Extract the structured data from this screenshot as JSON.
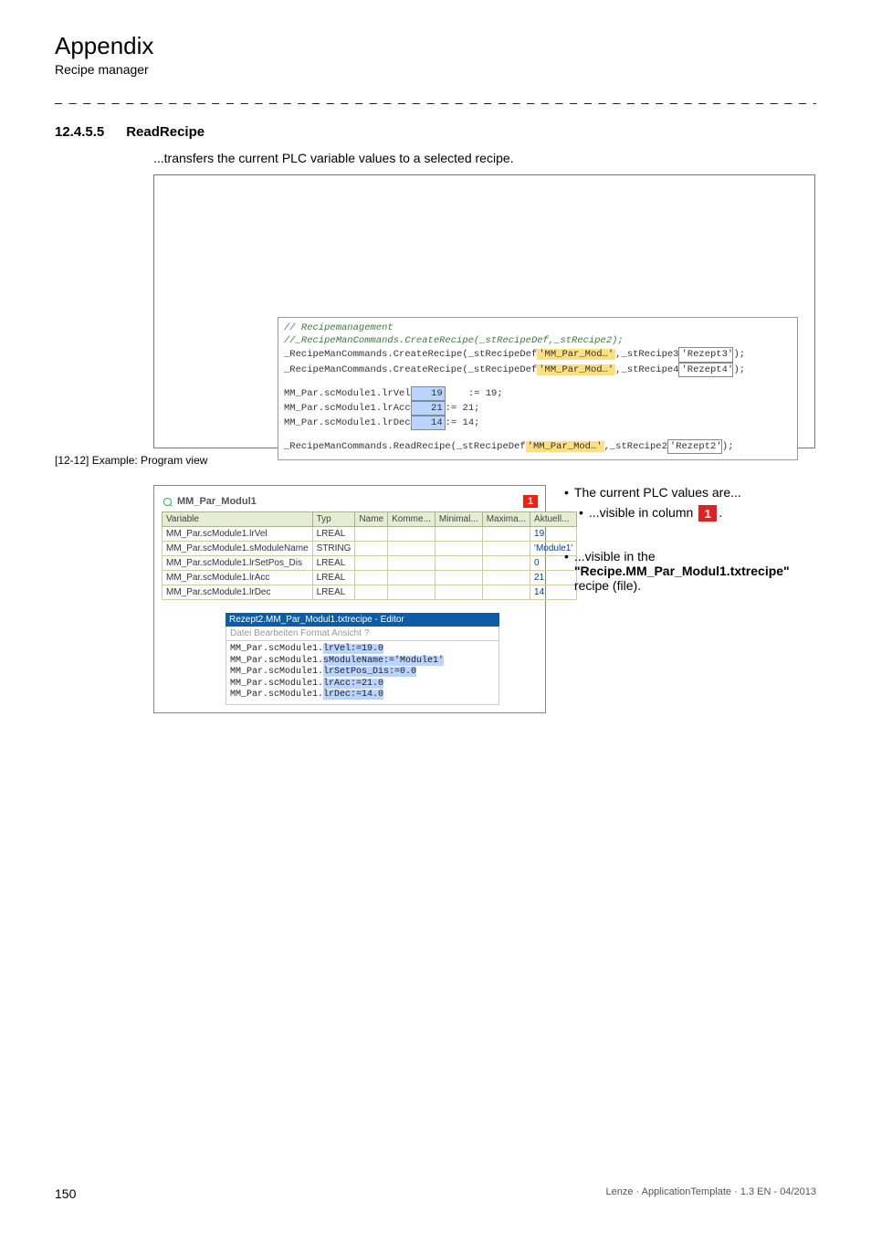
{
  "header": {
    "title": "Appendix",
    "subtitle": "Recipe manager"
  },
  "section": {
    "number": "12.4.5.5",
    "title": "ReadRecipe",
    "description": "...transfers the current PLC variable values to a selected recipe."
  },
  "code_panel": {
    "c1": "// Recipemanagement",
    "c2": "//_RecipeManCommands.CreateRecipe(_stRecipeDef,_stRecipe2);",
    "l3a": "_RecipeManCommands.CreateRecipe(_stRecipeDef",
    "l3b": "'MM_Par_Mod…'",
    "l3c": ",_stRecipe3",
    "l3d": "'Rezept3'",
    "l3e": ");",
    "l4a": "_RecipeManCommands.CreateRecipe(_stRecipeDef",
    "l4b": "'MM_Par_Mod…'",
    "l4c": ",_stRecipe4",
    "l4d": "'Rezept4'",
    "l4e": ");",
    "v1a": "MM_Par.scModule1.lrVel",
    "v1b": "19",
    "v1c": ":= 19;",
    "v2a": "MM_Par.scModule1.lrAcc",
    "v2b": "21",
    "v2c": ":= 21;",
    "v3a": "MM_Par.scModule1.lrDec",
    "v3b": "14",
    "v3c": ":= 14;",
    "r1a": "_RecipeManCommands.ReadRecipe(_stRecipeDef",
    "r1b": "'MM_Par_Mod…'",
    "r1c": ",_stRecipe2",
    "r1d": "'Rezept2'",
    "r1e": ");"
  },
  "caption": {
    "num": "[12-12]",
    "text": "Example: Program view"
  },
  "tab": {
    "label": "MM_Par_Modul1",
    "badge": "1"
  },
  "grid": {
    "headers": [
      "Variable",
      "Typ",
      "Name",
      "Komme...",
      "Minimal...",
      "Maxima...",
      "Aktuell..."
    ],
    "rows": [
      [
        "MM_Par.scModule1.lrVel",
        "LREAL",
        "",
        "",
        "",
        "",
        "19"
      ],
      [
        "MM_Par.scModule1.sModuleName",
        "STRING",
        "",
        "",
        "",
        "",
        "'Module1'"
      ],
      [
        "MM_Par.scModule1.lrSetPos_Dis",
        "LREAL",
        "",
        "",
        "",
        "",
        "0"
      ],
      [
        "MM_Par.scModule1.lrAcc",
        "LREAL",
        "",
        "",
        "",
        "",
        "21"
      ],
      [
        "MM_Par.scModule1.lrDec",
        "LREAL",
        "",
        "",
        "",
        "",
        "14"
      ]
    ]
  },
  "editor": {
    "title": "Rezept2.MM_Par_Modul1.txtrecipe - Editor",
    "menu": "Datei  Bearbeiten  Format  Ansicht  ?",
    "l1a": "MM_Par.scModule1.",
    "l1b": "lrVel:=19.0",
    "l2a": "MM_Par.scModule1.",
    "l2b": "sModuleName:='Module1'",
    "l3a": "MM_Par.scModule1.",
    "l3b": "lrSetPos_Dis:=0.0",
    "l4a": "MM_Par.scModule1.",
    "l4b": "lrAcc:=21.0",
    "l5a": "MM_Par.scModule1.",
    "l5b": "lrDec:=14.0"
  },
  "bullets": {
    "b1": "The current PLC values are...",
    "b2a": "...visible in column ",
    "b2num": "1",
    "b2b": ".",
    "b3": "...visible in the",
    "b3b": "\"Recipe.MM_Par_Modul1.txtrecipe\"",
    "b3c": " recipe (file)."
  },
  "footer": {
    "page": "150",
    "doc": "Lenze · ApplicationTemplate · 1.3 EN - 04/2013"
  }
}
